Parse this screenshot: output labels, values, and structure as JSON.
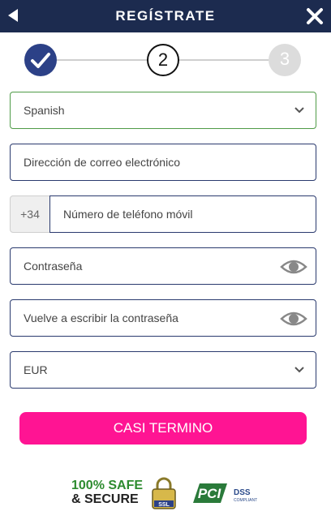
{
  "header": {
    "title": "REGÍSTRATE",
    "back_icon": "back-arrow-icon",
    "close_icon": "close-icon"
  },
  "stepper": {
    "current_step": 2,
    "step2": "2",
    "step3": "3"
  },
  "form": {
    "language": "Spanish",
    "email_placeholder": "Dirección de correo electrónico",
    "phone_prefix": "+34",
    "phone_placeholder": "Número de teléfono móvil",
    "password_placeholder": "Contraseña",
    "password_repeat_placeholder": "Vuelve a escribir la contraseña",
    "currency": "EUR",
    "submit_label": "CASI TERMINO"
  },
  "badges": {
    "safe_line1": "100% SAFE",
    "safe_line2": "& SECURE",
    "ssl": "SSL",
    "pci": "PCI",
    "dss": "DSS",
    "compliant": "COMPLIANT"
  },
  "colors": {
    "header_bg": "#1c2b4f",
    "accent": "#2c4187",
    "submit": "#ff1493",
    "border": "#2a3a6e",
    "valid_border": "#4f9b47"
  }
}
